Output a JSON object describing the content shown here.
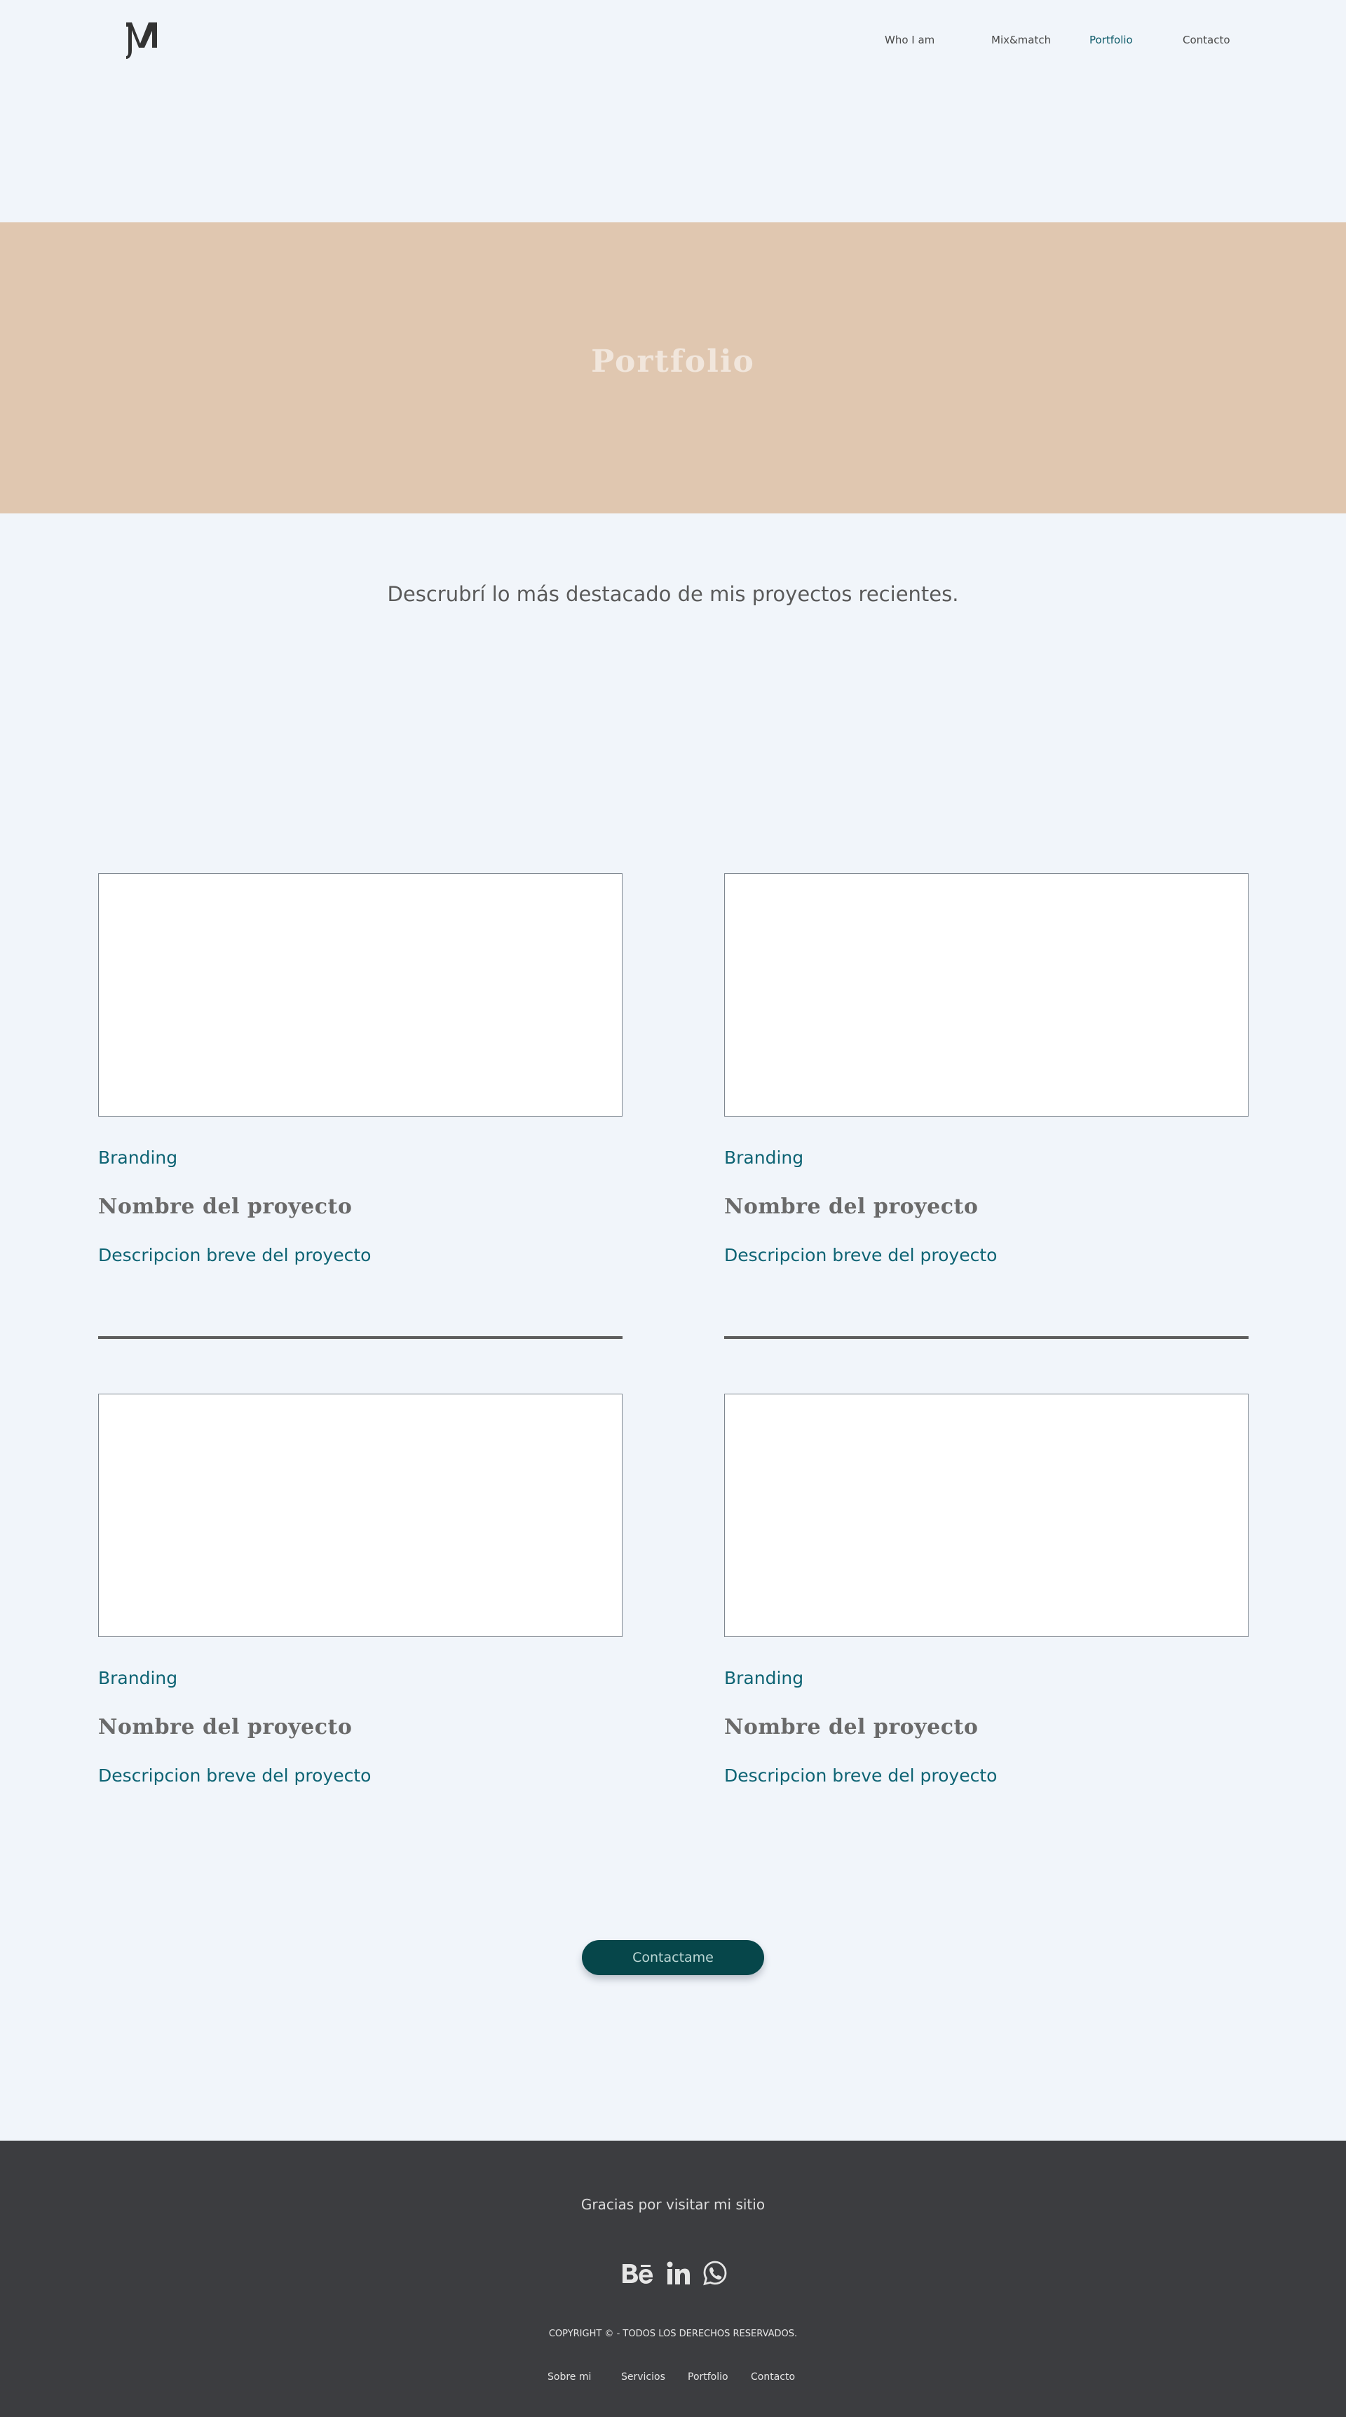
{
  "header": {
    "logo_text": "M",
    "nav": [
      {
        "label": "Who I am",
        "active": false
      },
      {
        "label": "Mix&match",
        "active": false
      },
      {
        "label": "Portfolio",
        "active": true
      },
      {
        "label": "Contacto",
        "active": false
      }
    ]
  },
  "hero": {
    "title": "Portfolio",
    "background": "#e0c7b0"
  },
  "intro": {
    "text": "Descrubrí lo más destacado de mis proyectos recientes."
  },
  "projects": [
    {
      "category": "Branding",
      "name": "Nombre del proyecto",
      "description": "Descripcion breve del proyecto"
    },
    {
      "category": "Branding",
      "name": "Nombre del proyecto",
      "description": "Descripcion breve del proyecto"
    },
    {
      "category": "Branding",
      "name": "Nombre del proyecto",
      "description": "Descripcion breve del proyecto"
    },
    {
      "category": "Branding",
      "name": "Nombre del proyecto",
      "description": "Descripcion breve del proyecto"
    }
  ],
  "cta": {
    "label": "Contactame",
    "color": "#06464a"
  },
  "footer": {
    "thanks": "Gracias por visitar mi sitio",
    "socials": [
      "behance-icon",
      "linkedin-icon",
      "whatsapp-icon"
    ],
    "copyright": "COPYRIGHT ©  - TODOS LOS DERECHOS RESERVADOS.",
    "nav": [
      "Sobre mi",
      "Servicios",
      "Portfolio",
      "Contacto"
    ],
    "background": "#3c3d40"
  },
  "colors": {
    "accent": "#0e6474",
    "page_background": "#f1f5fa"
  }
}
